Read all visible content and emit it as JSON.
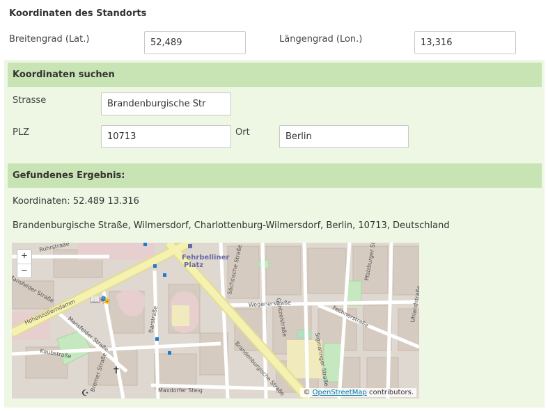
{
  "location": {
    "title": "Koordinaten des Standorts",
    "lat_label": "Breitengrad (Lat.)",
    "lat_value": "52,489",
    "lon_label": "Längengrad (Lon.)",
    "lon_value": "13,316"
  },
  "search": {
    "title": "Koordinaten suchen",
    "street_label": "Strasse",
    "street_value": "Brandenburgische Str",
    "zip_label": "PLZ",
    "zip_value": "10713",
    "city_label": "Ort",
    "city_value": "Berlin"
  },
  "result": {
    "title": "Gefundenes Ergebnis:",
    "coordinates": "Koordinaten: 52.489 13.316",
    "address": "Brandenburgische Straße, Wilmersdorf, Charlottenburg-Wilmersdorf, Berlin, 10713, Deutschland"
  },
  "map": {
    "zoom_in": "+",
    "zoom_out": "−",
    "attribution_prefix": "© ",
    "attribution_link": "OpenStreetMap",
    "attribution_suffix": " contributors.",
    "place_label_1": "Fehrbelliner",
    "place_label_2": "Platz",
    "streets": {
      "s1": "Ruhrstraße",
      "s2": "Hohenzollerndamm",
      "s3": "Mansfelder Straße",
      "s4": "Brandenburgische Straße",
      "s5": "Wegenerstraße",
      "s6": "Sächsische Straße",
      "s7": "Pfalzburger Straße",
      "s8": "Uhlandstraße",
      "s9": "Fechnerstraße",
      "s10": "Kaubstraße",
      "s11": "Maxdorfer Steig",
      "s12": "Barstraße",
      "s13": "Bremer Straße",
      "s14": "Güntzelstraße",
      "s15": "Sigmaringer Straße",
      "s16": "Mansfelder Straße"
    }
  }
}
